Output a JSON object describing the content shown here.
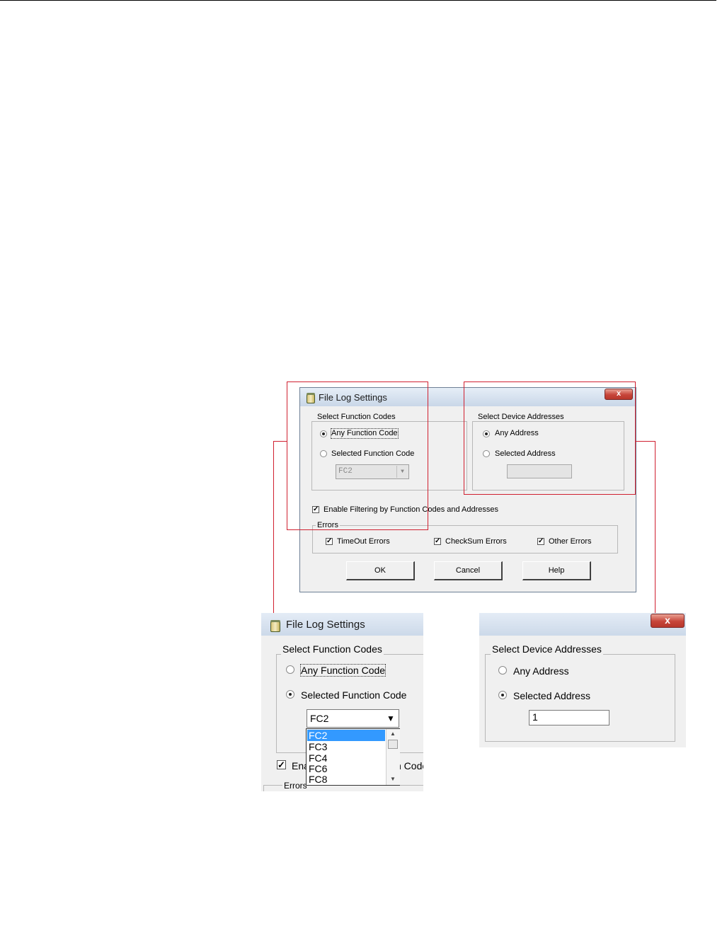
{
  "dialog": {
    "title": "File Log Settings",
    "close_glyph": "x",
    "function_codes": {
      "group_label": "Select Function Codes",
      "any_label": "Any Function Code",
      "selected_label": "Selected Function Code",
      "combo_value": "FC2",
      "any_checked": true
    },
    "device_addresses": {
      "group_label": "Select Device Addresses",
      "any_label": "Any Address",
      "selected_label": "Selected Address",
      "any_checked": true
    },
    "enable_filtering_label": "Enable Filtering by Function Codes and Addresses",
    "errors": {
      "group_label": "Errors",
      "timeout_label": "TimeOut Errors",
      "checksum_label": "CheckSum Errors",
      "other_label": "Other Errors"
    },
    "buttons": {
      "ok": "OK",
      "cancel": "Cancel",
      "help": "Help"
    }
  },
  "zoom_left": {
    "title": "File Log Settings",
    "group_label": "Select Function Codes",
    "any_label": "Any Function Code",
    "selected_label": "Selected Function Code",
    "combo_value": "FC2",
    "combo_arrow": "▼",
    "options": [
      "FC2",
      "FC3",
      "FC4",
      "FC6",
      "FC8"
    ],
    "selected_option": "FC2",
    "partial_enable_label": "Ena",
    "partial_code_label": "n Code",
    "partial_errors_label": "Errors"
  },
  "zoom_right": {
    "close_glyph": "x",
    "group_label": "Select Device Addresses",
    "any_label": "Any Address",
    "selected_label": "Selected Address",
    "address_value": "1"
  },
  "icons": [
    "file-log-icon",
    "close-icon",
    "chevron-down-icon",
    "scroll-up-icon",
    "scroll-down-icon",
    "check-icon"
  ]
}
